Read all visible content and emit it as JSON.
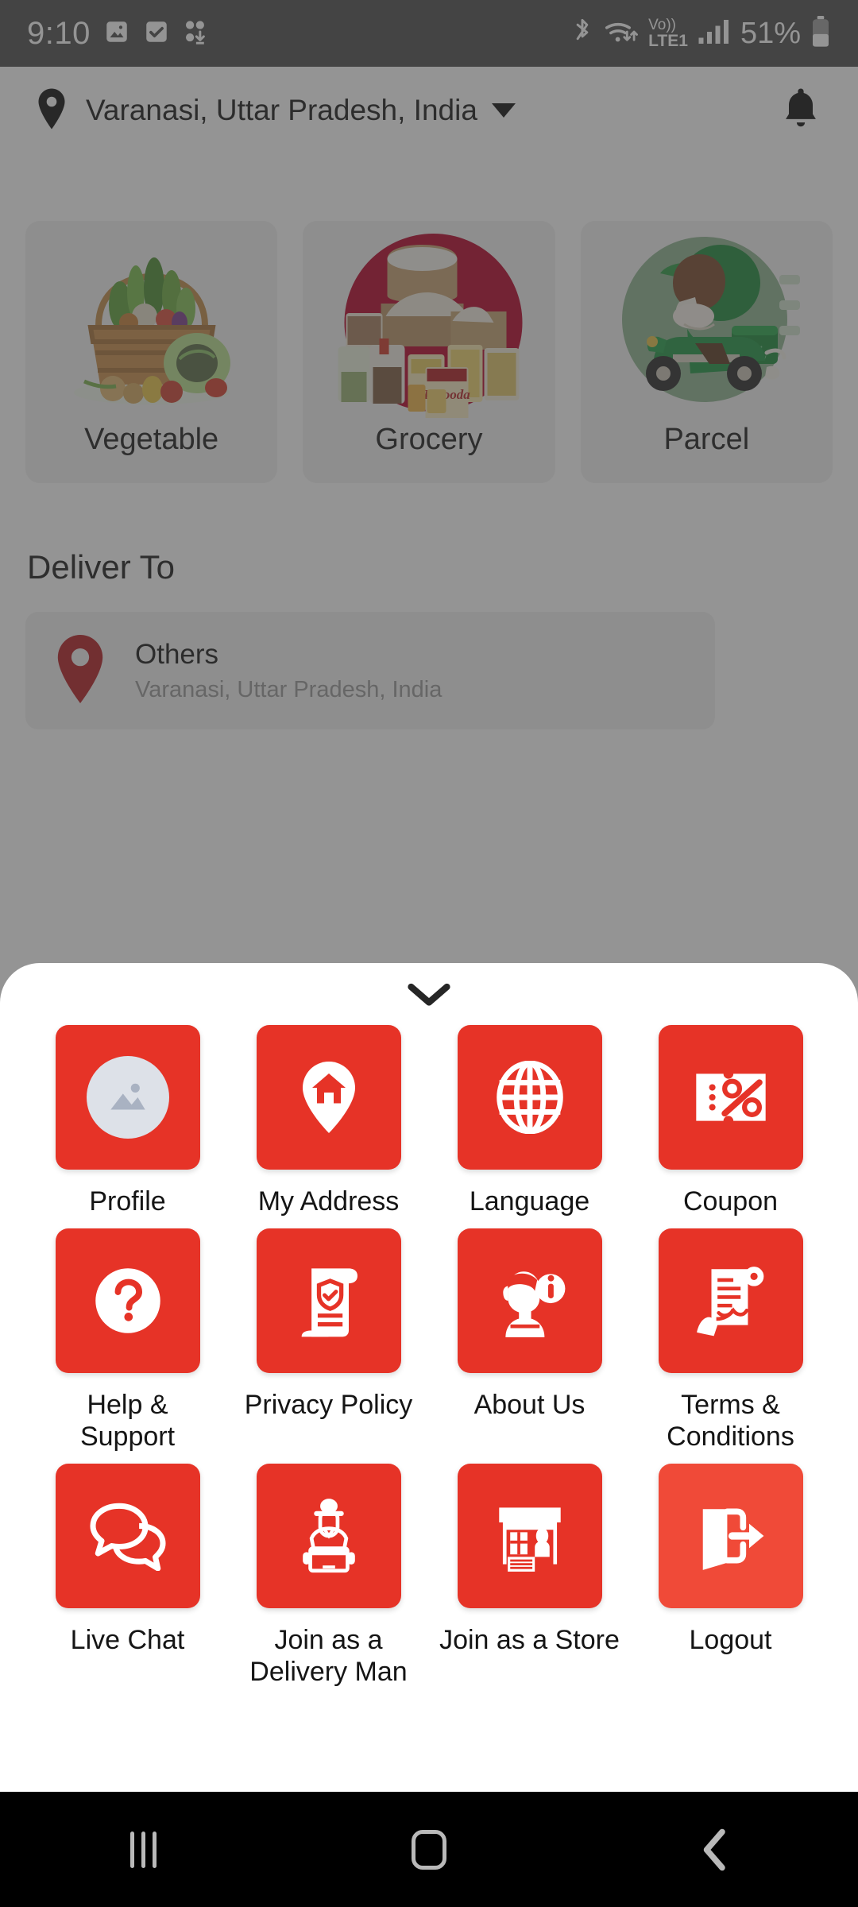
{
  "status_bar": {
    "time": "9:10",
    "left_icons": [
      "image-icon",
      "checkbox-icon",
      "download-icon"
    ],
    "right_icons": [
      "bluetooth-icon",
      "wifi-icon",
      "volte-icon",
      "signal-icon"
    ],
    "network_label": "Vo))",
    "network_sub": "LTE1",
    "battery_text": "51%"
  },
  "header": {
    "location": "Varanasi, Uttar Pradesh, India",
    "location_icon": "map-pin-icon",
    "dropdown_icon": "chevron-down-icon",
    "notification_icon": "bell-icon"
  },
  "categories": [
    {
      "label": "Vegetable",
      "icon": "vegetable-basket-image"
    },
    {
      "label": "Grocery",
      "icon": "grocery-products-image"
    },
    {
      "label": "Parcel",
      "icon": "delivery-scooter-image"
    }
  ],
  "deliver_to": {
    "title": "Deliver To",
    "pin_icon": "map-pin-icon",
    "name": "Others",
    "address": "Varanasi, Uttar Pradesh, India"
  },
  "sheet": {
    "collapse_icon": "chevron-down-icon",
    "menu": [
      {
        "label": "Profile",
        "icon": "profile-avatar-icon"
      },
      {
        "label": "My Address",
        "icon": "home-pin-icon"
      },
      {
        "label": "Language",
        "icon": "globe-icon"
      },
      {
        "label": "Coupon",
        "icon": "coupon-percent-icon"
      },
      {
        "label": "Help & Support",
        "icon": "question-mark-icon"
      },
      {
        "label": "Privacy Policy",
        "icon": "shield-document-icon"
      },
      {
        "label": "About Us",
        "icon": "person-info-icon"
      },
      {
        "label": "Terms & Conditions",
        "icon": "contract-signing-icon"
      },
      {
        "label": "Live Chat",
        "icon": "chat-bubbles-icon"
      },
      {
        "label": "Join as a Delivery Man",
        "icon": "delivery-person-icon"
      },
      {
        "label": "Join as a Store",
        "icon": "store-stall-icon"
      },
      {
        "label": "Logout",
        "icon": "logout-arrow-icon"
      }
    ]
  },
  "navbar": {
    "recents": "recents-icon",
    "home": "home-icon",
    "back": "back-icon"
  },
  "colors": {
    "tile_red": "#E63327",
    "logout_red": "#F04A38",
    "pin_red": "#B42025",
    "scrim": "#6B6B6B",
    "status_bar": "#4F4F4F"
  }
}
